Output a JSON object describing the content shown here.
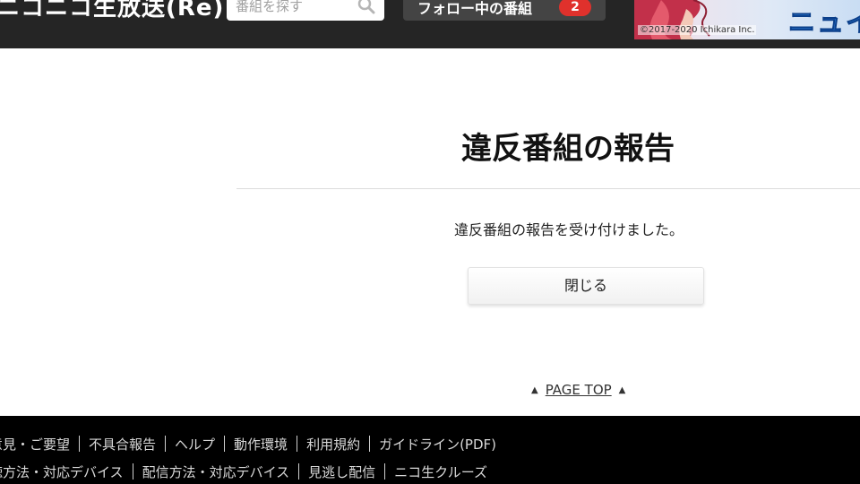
{
  "header": {
    "logo_text": "ニコニコ生放送(Re)",
    "search": {
      "placeholder": "番組を探す"
    },
    "follow": {
      "label": "フォロー中の番組",
      "count": "2"
    },
    "banner": {
      "text": "ニュイ",
      "copyright": "©2017-2020 Ichikara Inc."
    }
  },
  "main": {
    "title": "違反番組の報告",
    "message": "違反番組の報告を受け付けました。",
    "close_label": "閉じる",
    "page_top": "PAGE TOP"
  },
  "footer": {
    "row1": [
      "意見・ご要望",
      "不具合報告",
      "ヘルプ",
      "動作環境",
      "利用規約",
      "ガイドライン(PDF)"
    ],
    "row2": [
      "聴方法・対応デバイス",
      "配信方法・対応デバイス",
      "見逃し配信",
      "ニコ生クルーズ"
    ]
  },
  "colors": {
    "header_bg": "#252525",
    "badge": "#e0312c",
    "footer_bg": "#000000"
  }
}
